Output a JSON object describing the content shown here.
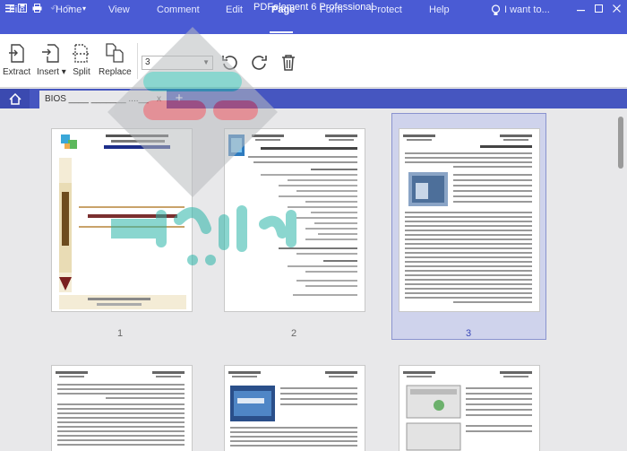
{
  "titlebar": {
    "title": "PDFelement 6 Professional",
    "quick_access": [
      "menu-icon",
      "save-icon",
      "print-icon",
      "undo-icon",
      "redo-icon",
      "customize-icon"
    ]
  },
  "window_controls": [
    "minimize-icon",
    "maximize-icon",
    "close-icon"
  ],
  "menu": {
    "items": [
      "File",
      "Home",
      "View",
      "Comment",
      "Edit",
      "Page",
      "Form",
      "Protect",
      "Help"
    ],
    "active": "Page",
    "search_label": "I want to..."
  },
  "toolbar": {
    "extract": "Extract",
    "insert": "Insert",
    "split": "Split",
    "replace": "Replace",
    "page_select_value": "3"
  },
  "tabs": {
    "doc_title": "BIOS ____ _______ ....__",
    "close": "x"
  },
  "pages": [
    {
      "number": "1"
    },
    {
      "number": "2"
    },
    {
      "number": "3",
      "selected": true
    }
  ],
  "colors": {
    "brand": "#4a5bd4",
    "tab_bar": "#4656c0",
    "selection": "#cfd3ec",
    "watermark_teal": "#2bb5a8",
    "watermark_red": "#e04a55",
    "watermark_gray": "#b9bcbf"
  }
}
